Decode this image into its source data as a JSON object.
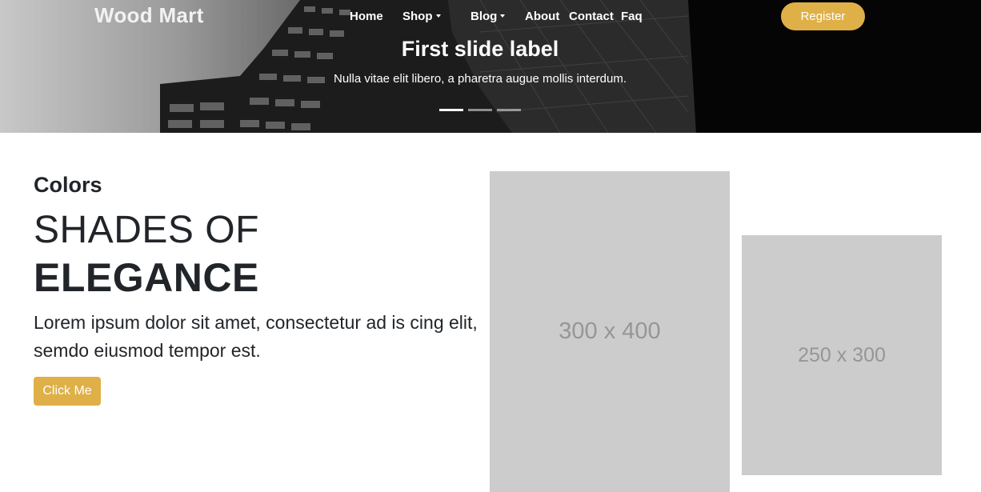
{
  "header": {
    "brand": "Wood Mart",
    "nav": [
      {
        "label": "Home",
        "dropdown": false
      },
      {
        "label": "Shop",
        "dropdown": true
      },
      {
        "label": "Blog",
        "dropdown": true
      },
      {
        "label": "About",
        "dropdown": false
      },
      {
        "label": "Contact",
        "dropdown": false
      },
      {
        "label": "Faq",
        "dropdown": false
      }
    ],
    "register_label": "Register"
  },
  "carousel": {
    "slide_title": "First slide label",
    "slide_caption": "Nulla vitae elit libero, a pharetra augue mollis interdum.",
    "slide_count": 3,
    "active_index": 0
  },
  "feature": {
    "eyebrow": "Colors",
    "headline_light": "SHADES OF",
    "headline_bold": "ELEGANCE",
    "description": "Lorem ipsum dolor sit amet, consectetur ad is cing elit, semdo eiusmod tempor est.",
    "button_label": "Click Me"
  },
  "images": [
    {
      "label": "300 x 400"
    },
    {
      "label": "250 x 300"
    }
  ],
  "colors": {
    "accent": "#dfb047",
    "placeholder_bg": "#cccccc",
    "placeholder_text": "#969696"
  }
}
